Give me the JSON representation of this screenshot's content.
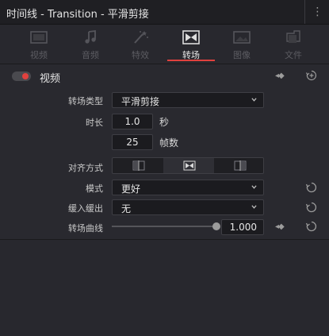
{
  "window": {
    "title": "时间线 - Transition - 平滑剪接",
    "menu_icon": "more-vertical-icon"
  },
  "tabs": [
    {
      "label": "视频",
      "icon": "video-icon"
    },
    {
      "label": "音频",
      "icon": "music-note-icon"
    },
    {
      "label": "特效",
      "icon": "magic-wand-icon"
    },
    {
      "label": "转场",
      "icon": "transition-icon",
      "active": true
    },
    {
      "label": "图像",
      "icon": "image-icon"
    },
    {
      "label": "文件",
      "icon": "file-icon"
    }
  ],
  "section": {
    "label": "视频",
    "enabled": true,
    "accent": "#e0413e"
  },
  "fields": {
    "transition_type": {
      "label": "转场类型",
      "value": "平滑剪接"
    },
    "duration": {
      "label": "时长",
      "seconds": "1.0",
      "seconds_unit": "秒",
      "frames": "25",
      "frames_unit": "帧数"
    },
    "alignment": {
      "label": "对齐方式",
      "options": [
        "start-on-edit-icon",
        "center-on-edit-icon",
        "end-on-edit-icon"
      ],
      "selected_index": 1
    },
    "mode": {
      "label": "模式",
      "value": "更好"
    },
    "ease": {
      "label": "缓入缓出",
      "value": "无"
    },
    "curve": {
      "label": "转场曲线",
      "value": "1.000",
      "level": 1.0
    }
  }
}
